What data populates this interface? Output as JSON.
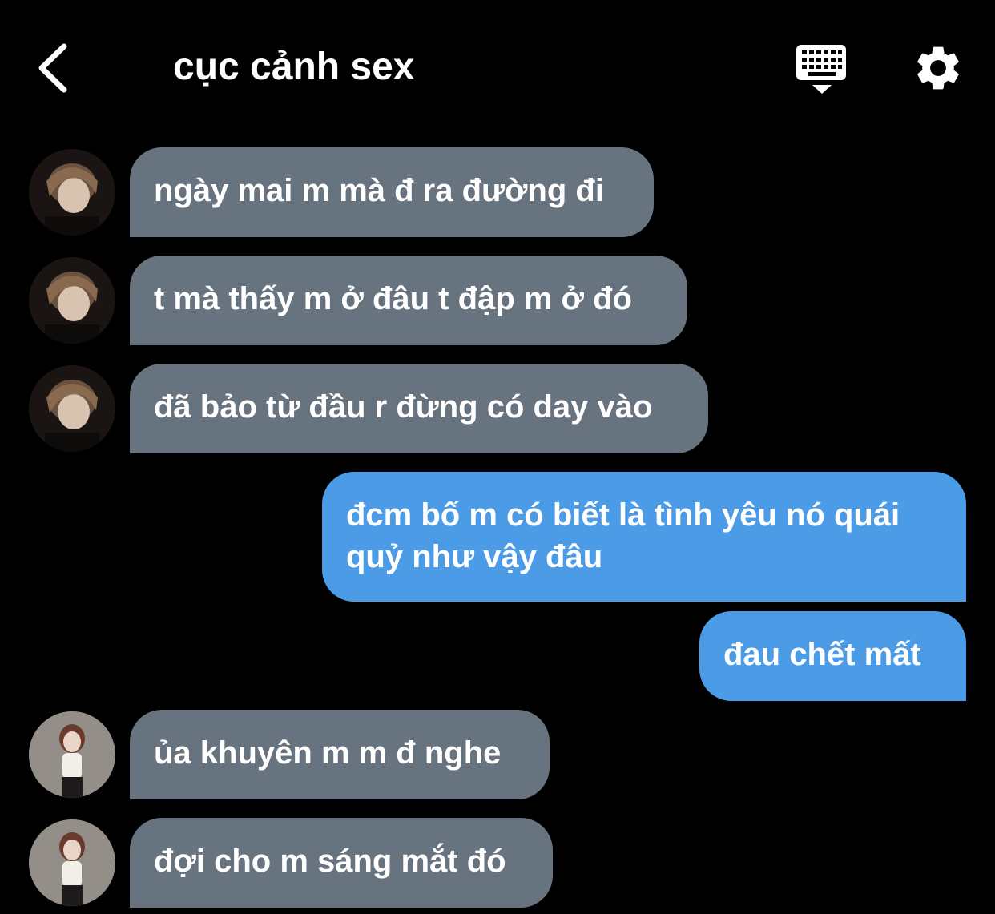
{
  "header": {
    "title": "cục cảnh sex",
    "back_icon": "chevron-left-icon",
    "keyboard_icon": "keyboard-icon",
    "settings_icon": "gear-icon"
  },
  "colors": {
    "background": "#000000",
    "incoming_bubble": "#67737f",
    "outgoing_bubble": "#4b9be6",
    "text": "#ffffff"
  },
  "messages": [
    {
      "direction": "in",
      "sender_avatar": "avatar-a",
      "text": "ngày mai m mà đ ra đường đi"
    },
    {
      "direction": "in",
      "sender_avatar": "avatar-a",
      "text": "t mà thấy m ở đâu t đập m ở đó"
    },
    {
      "direction": "in",
      "sender_avatar": "avatar-a",
      "text": "đã bảo từ đầu r đừng có day vào"
    },
    {
      "direction": "out",
      "lines": [
        "đcm bố m có biết là tình yêu nó quái",
        "quỷ như vậy đâu"
      ]
    },
    {
      "direction": "out",
      "text": "đau chết mất"
    },
    {
      "direction": "in",
      "sender_avatar": "avatar-b",
      "text": "ủa khuyên m m đ nghe"
    },
    {
      "direction": "in",
      "sender_avatar": "avatar-b",
      "text": "đợi cho m sáng mắt đó"
    }
  ]
}
